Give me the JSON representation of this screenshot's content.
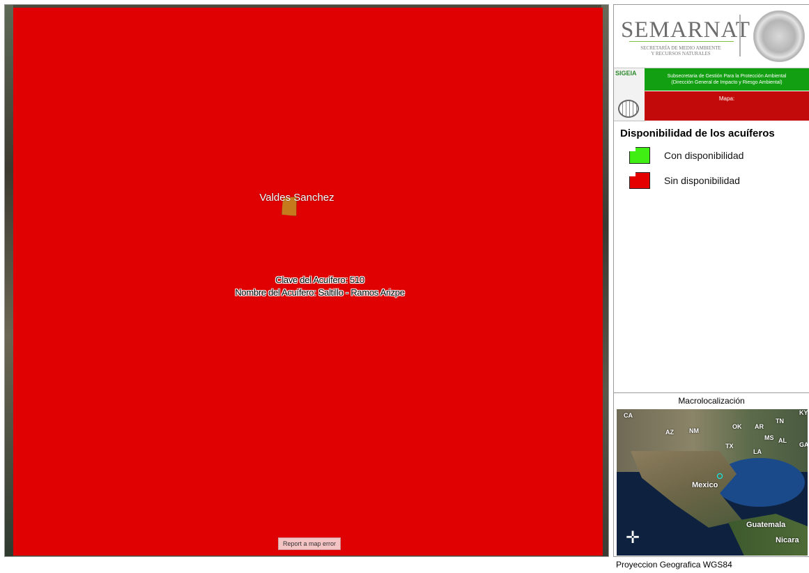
{
  "map": {
    "place_label": "Valdes Sanchez",
    "clave_label": "Clave del Acuífero: 510",
    "nombre_label": "Nombre del Acuífero: Saltillo - Ramos Arizpe",
    "report_button": "Report a map error",
    "fill_color": "#e00202"
  },
  "panel": {
    "semarnat_title": "SEMARNAT",
    "semarnat_sub_1": "SECRETARÍA DE MEDIO AMBIENTE",
    "semarnat_sub_2": "Y RECURSOS NATURALES",
    "sigeia_label": "SIGEIA",
    "subsecretaria_1": "Subsecretaria de Gestión Para la Protección Ambiental",
    "subsecretaria_2": "(Dirección General de Impacto y Riesgo Ambiental)",
    "mapa_label": "Mapa:",
    "legend": {
      "title": "Disponibilidad de los acuíferos",
      "items": [
        {
          "label": "Con disponibilidad",
          "color": "#40ee14"
        },
        {
          "label": "Sin disponibilidad",
          "color": "#e50000"
        }
      ]
    },
    "macro": {
      "title": "Macrolocalización",
      "labels": {
        "ca": "CA",
        "az": "AZ",
        "nm": "NM",
        "ok": "OK",
        "ar": "AR",
        "tn": "TN",
        "tx": "TX",
        "ms": "MS",
        "al": "AL",
        "la": "LA",
        "ca2": "GA",
        "ky": "KY",
        "mexico": "Mexico",
        "guatemala": "Guatemala",
        "nicara": "Nicara"
      }
    },
    "projection": "Proyeccion Geografica WGS84"
  },
  "colors": {
    "sigeia_green": "#12a012",
    "mapa_red": "#c30a0a"
  }
}
